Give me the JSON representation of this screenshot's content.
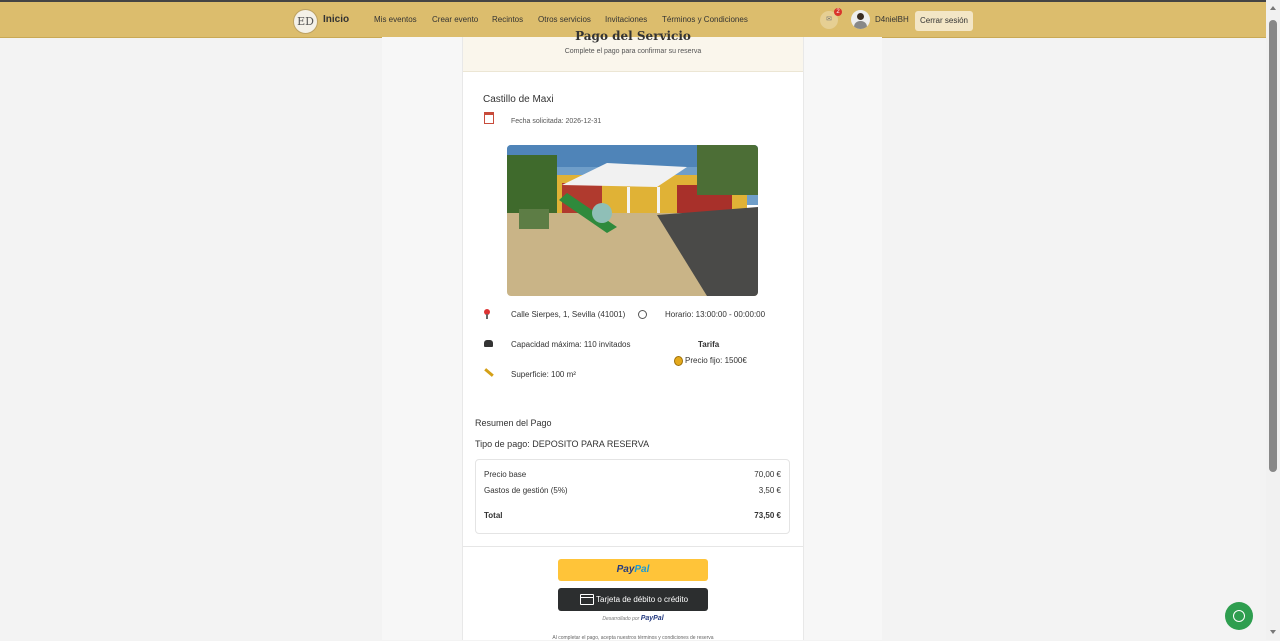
{
  "nav": {
    "logo": "ED",
    "brand": "Inicio",
    "links": [
      "Mis eventos",
      "Crear evento",
      "Recintos",
      "Otros servicios",
      "Invitaciones",
      "Términos y Condiciones"
    ],
    "notification_count": "2",
    "username": "D4nielBH",
    "logout_label": "Cerrar sesión"
  },
  "page": {
    "title": "Pago del Servicio",
    "subtitle": "Complete el pago para confirmar su reserva"
  },
  "venue": {
    "name": "Castillo de Maxi",
    "date": "Fecha solicitada: 2026-12-31",
    "address": "Calle Sierpes, 1, Sevilla (41001)",
    "schedule": "Horario: 13:00:00 - 00:00:00",
    "capacity": "Capacidad máxima: 110 invitados",
    "surface": "Superficie: 100 m²",
    "tarifa_title": "Tarifa",
    "tarifa_value": "Precio fijo: 1500€"
  },
  "summary": {
    "title": "Resumen del Pago",
    "payment_type": "Tipo de pago: DEPOSITO PARA RESERVA",
    "base_label": "Precio base",
    "base_value": "70,00 €",
    "fee_label": "Gastos de gestión (5%)",
    "fee_value": "3,50 €",
    "total_label": "Total",
    "total_value": "73,50 €"
  },
  "payment": {
    "paypal_part1": "Pay",
    "paypal_part2": "Pal",
    "card_label": "Tarjeta de débito o crédito",
    "powered_by": "Desarrollado por",
    "powered_brand": "PayPal",
    "terms_note": "Al completar el pago, acepta nuestros términos y condiciones de reserva"
  }
}
